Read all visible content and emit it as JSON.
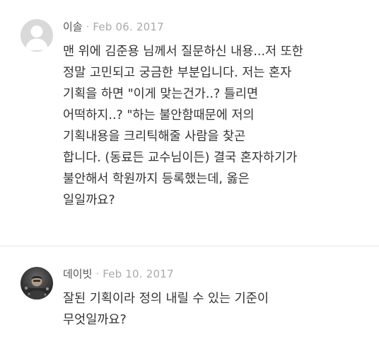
{
  "comments": [
    {
      "author": "이솔",
      "separator": "·",
      "date": "Feb 06. 2017",
      "avatar": "default-user-icon",
      "lines": [
        "맨 위에 김준용 님께서 질문하신 내용...저 또한",
        "정말 고민되고 궁금한 부분입니다. 저는 혼자",
        "기획을 하면 \"이게 맞는건가..? 틀리면",
        "어떡하지..? \"하는 불안함때문에 저의",
        "기획내용을 크리틱해줄 사람을 찾곤",
        "합니다. (동료든 교수님이든) 결국 혼자하기가",
        "불안해서 학원까지 등록했는데, 옳은",
        "일일까요?"
      ]
    },
    {
      "author": "데이빗",
      "separator": "·",
      "date": "Feb 10. 2017",
      "avatar": "user-photo",
      "lines": [
        "잘된 기획이라 정의 내릴 수 있는 기준이",
        "무엇일까요?"
      ]
    }
  ],
  "colors": {
    "author": "#555555",
    "date": "#aaaaaa",
    "body_text": "#333333",
    "divider": "#e6e6e6",
    "default_avatar_bg": "#d9d9d9"
  }
}
